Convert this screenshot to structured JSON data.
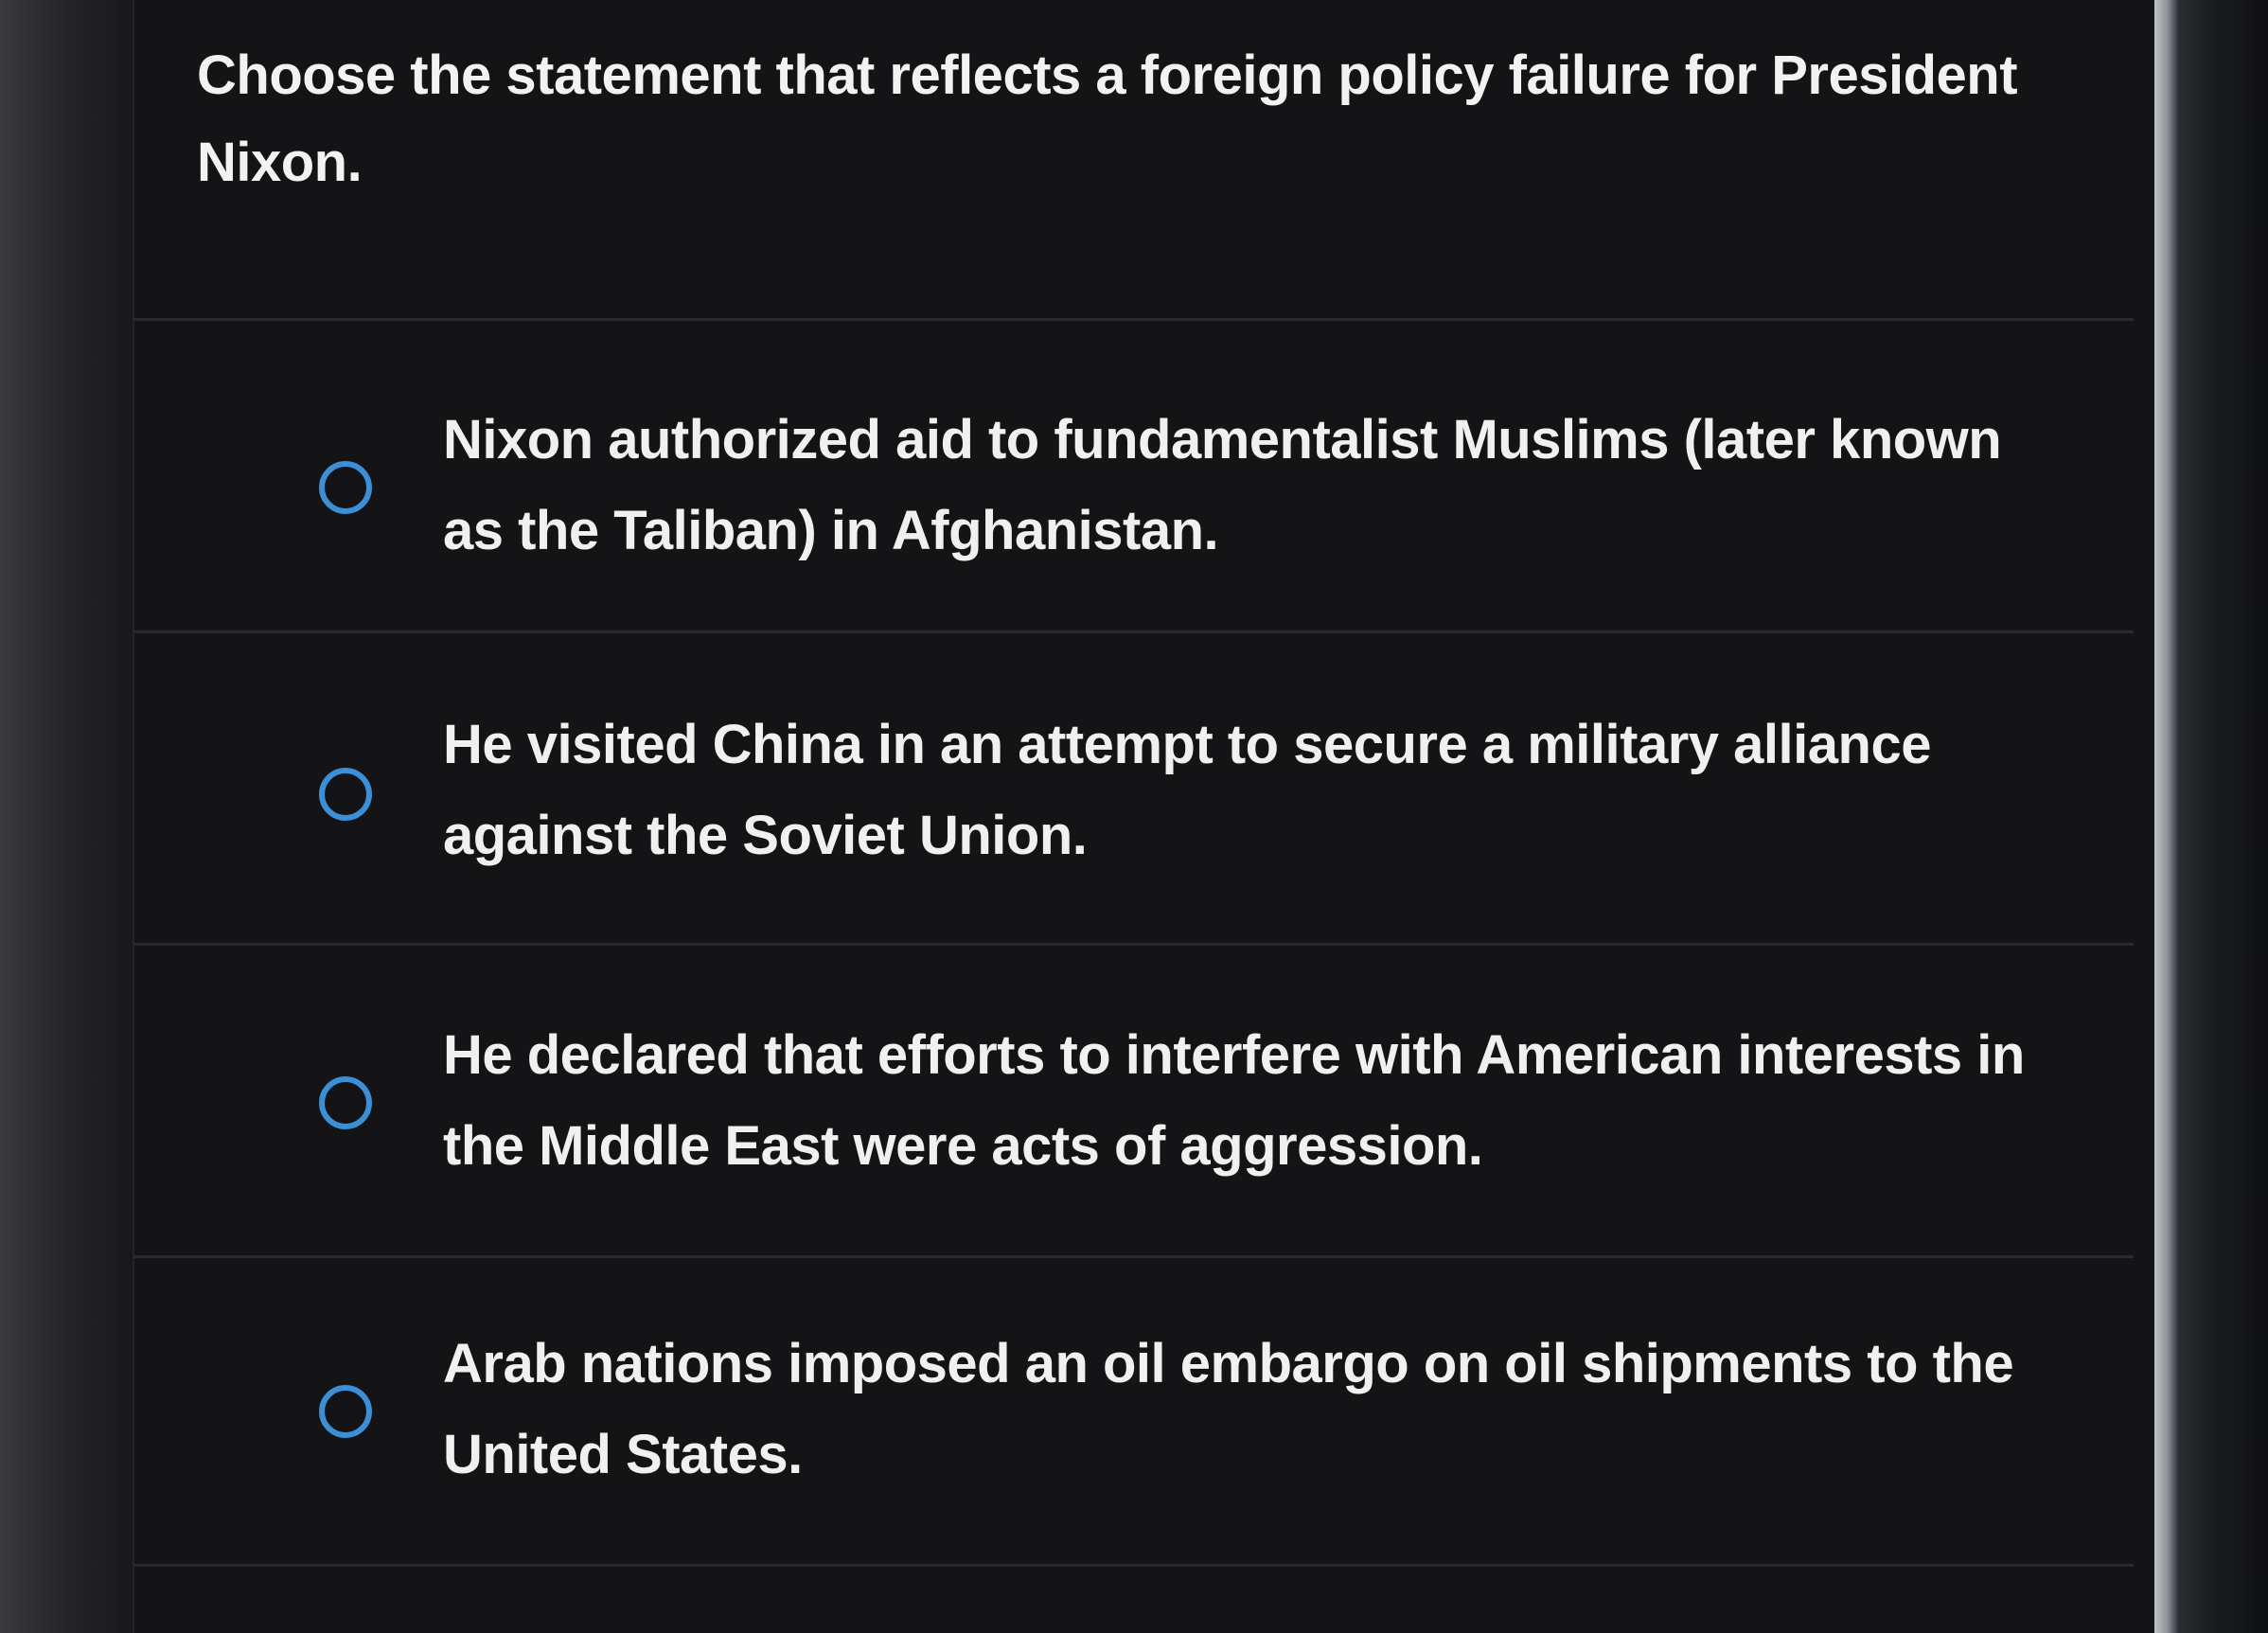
{
  "question": {
    "text": "Choose the statement that reflects a foreign policy failure for President Nixon."
  },
  "options": [
    {
      "label": "Nixon authorized aid to fundamentalist Muslims (later known as the Taliban) in Afghanistan.",
      "selected": false
    },
    {
      "label": "He visited China in an attempt to secure a military alliance against the Soviet Union.",
      "selected": false
    },
    {
      "label": "He declared that efforts to interfere with American interests in the Middle East were acts of aggression.",
      "selected": false
    },
    {
      "label": "Arab nations imposed an oil embargo on oil shipments to the United States.",
      "selected": false
    }
  ],
  "colors": {
    "background": "#141416",
    "text": "#f0f0f0",
    "radio_accent": "#3b8fd6",
    "divider": "#2a2a2d"
  }
}
